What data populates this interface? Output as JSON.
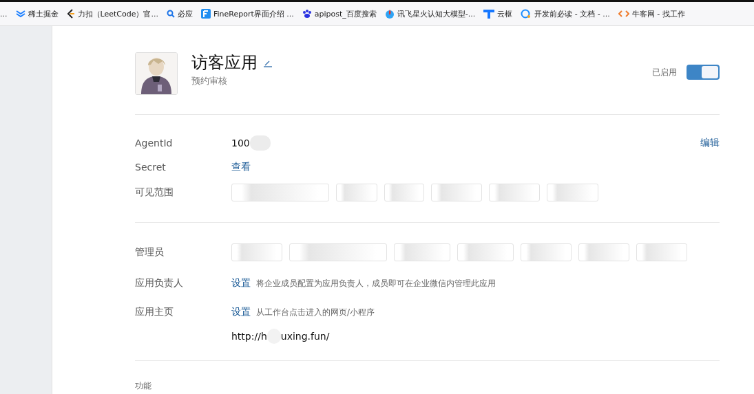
{
  "bookmarks": [
    {
      "label": "..."
    },
    {
      "label": "稀土掘金"
    },
    {
      "label": "力扣（LeetCode）官..."
    },
    {
      "label": "必应"
    },
    {
      "label": "FineReport界面介绍 ..."
    },
    {
      "label": "apipost_百度搜索"
    },
    {
      "label": "讯飞星火认知大模型-..."
    },
    {
      "label": "云枢"
    },
    {
      "label": "开发前必读 - 文档 - ..."
    },
    {
      "label": "牛客网 - 找工作"
    }
  ],
  "app": {
    "name": "访客应用",
    "description": "预约审核",
    "status_label": "已启用",
    "enabled": true
  },
  "info": {
    "agent_id_label": "AgentId",
    "agent_id_value": "100",
    "edit_link": "编辑",
    "secret_label": "Secret",
    "secret_link": "查看",
    "scope_label": "可见范围",
    "scope_chips": [
      {
        "kind": "redacted"
      },
      {
        "kind": "redacted"
      },
      {
        "kind": "redacted"
      },
      {
        "kind": "redacted"
      },
      {
        "kind": "redacted"
      },
      {
        "kind": "redacted"
      }
    ]
  },
  "admins": {
    "admins_label": "管理员",
    "admin_chips": [
      {
        "kind": "redacted"
      },
      {
        "kind": "redacted"
      },
      {
        "kind": "redacted"
      },
      {
        "kind": "redacted"
      },
      {
        "kind": "redacted"
      },
      {
        "kind": "redacted"
      },
      {
        "kind": "redacted"
      }
    ],
    "owner_label": "应用负责人",
    "owner_link": "设置",
    "owner_hint": "将企业成员配置为应用负责人，成员即可在企业微信内管理此应用",
    "home_label": "应用主页",
    "home_link": "设置",
    "home_hint": "从工作台点击进入的网页/小程序",
    "home_url_start": "http://h",
    "home_url_end": "uxing.fun/"
  },
  "section_title": "功能"
}
